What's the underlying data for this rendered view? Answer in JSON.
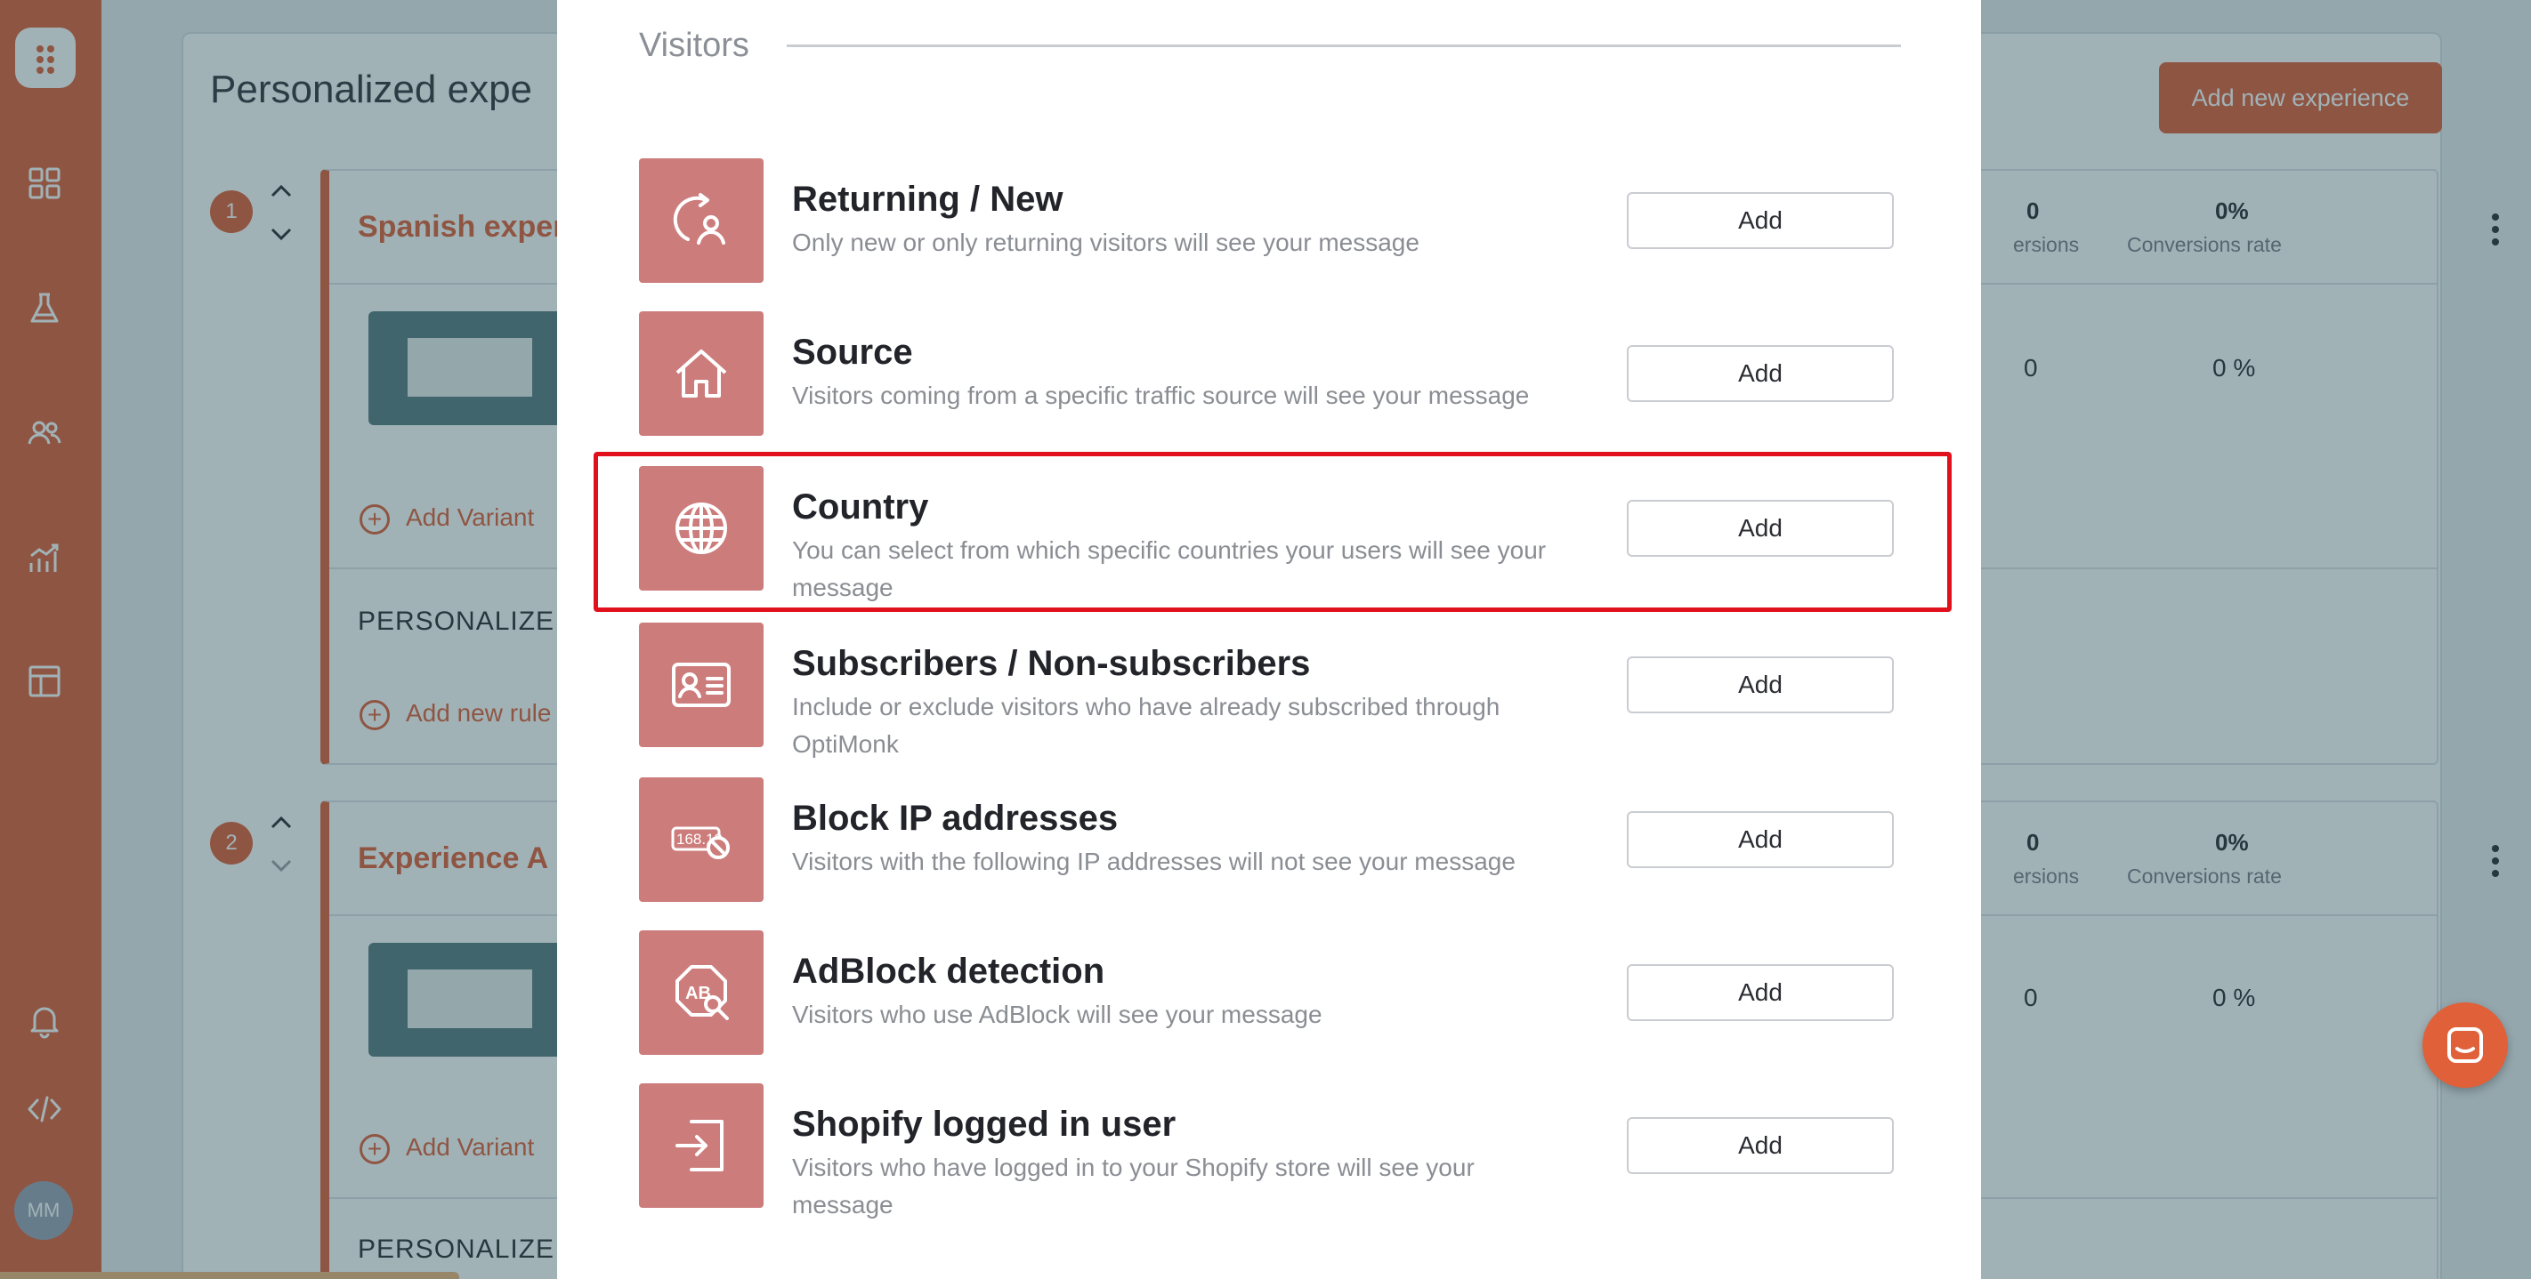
{
  "sidebar": {
    "items": [
      {
        "name": "dashboard-icon"
      },
      {
        "name": "flask-icon"
      },
      {
        "name": "users-icon"
      },
      {
        "name": "analytics-icon"
      },
      {
        "name": "templates-icon"
      },
      {
        "name": "bell-icon"
      },
      {
        "name": "code-icon"
      }
    ],
    "avatar_initials": "MM"
  },
  "background": {
    "title": "Personalized expe",
    "add_button": "Add new experience",
    "experiences": [
      {
        "number": "1",
        "name": "Spanish exper",
        "conversions": "0",
        "conversions_label": "ersions",
        "conversion_rate": "0%",
        "conversion_rate_label": "Conversions rate",
        "row_conversions": "0",
        "row_rate": "0 %",
        "add_variant": "Add Variant",
        "personalize": "PERSONALIZE",
        "add_rule": "Add new rule"
      },
      {
        "number": "2",
        "name": "Experience A",
        "conversions": "0",
        "conversions_label": "ersions",
        "conversion_rate": "0%",
        "conversion_rate_label": "Conversions rate",
        "row_conversions": "0",
        "row_rate": "0 %",
        "add_variant": "Add Variant",
        "personalize": "PERSONALIZE"
      }
    ]
  },
  "modal": {
    "section_title": "Visitors",
    "rows": [
      {
        "icon": "returning-visitor-icon",
        "title": "Returning / New",
        "description": "Only new or only returning visitors will see your message",
        "button": "Add"
      },
      {
        "icon": "home-icon",
        "title": "Source",
        "description": "Visitors coming from a specific traffic source will see your message",
        "button": "Add"
      },
      {
        "icon": "globe-icon",
        "title": "Country",
        "description": "You can select from which specific countries your users will see your message",
        "button": "Add"
      },
      {
        "icon": "id-card-icon",
        "title": "Subscribers / Non-subscribers",
        "description": "Include or exclude visitors who have already subscribed through OptiMonk",
        "button": "Add"
      },
      {
        "icon": "ip-block-icon",
        "ip_text": "168.19",
        "title": "Block IP addresses",
        "description": "Visitors with the following IP addresses will not see your message",
        "button": "Add"
      },
      {
        "icon": "adblock-icon",
        "ab_text": "AB",
        "title": "AdBlock detection",
        "description": "Visitors who use AdBlock will see your message",
        "button": "Add"
      },
      {
        "icon": "login-icon",
        "title": "Shopify logged in user",
        "description": "Visitors who have logged in to your Shopify store will see your message",
        "button": "Add"
      }
    ],
    "highlighted_row": "Country"
  },
  "colors": {
    "brand": "#e0603a",
    "icon_tile": "#cc7c7b",
    "highlight": "#e0101c"
  }
}
